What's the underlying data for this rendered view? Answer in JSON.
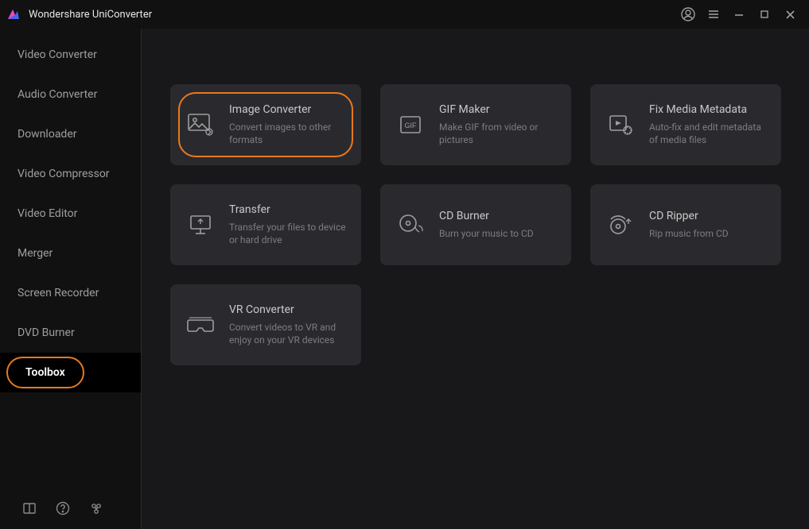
{
  "titlebar": {
    "app_name": "Wondershare UniConverter"
  },
  "sidebar": {
    "items": [
      {
        "label": "Video Converter",
        "id": "video-converter"
      },
      {
        "label": "Audio Converter",
        "id": "audio-converter"
      },
      {
        "label": "Downloader",
        "id": "downloader"
      },
      {
        "label": "Video Compressor",
        "id": "video-compressor"
      },
      {
        "label": "Video Editor",
        "id": "video-editor"
      },
      {
        "label": "Merger",
        "id": "merger"
      },
      {
        "label": "Screen Recorder",
        "id": "screen-recorder"
      },
      {
        "label": "DVD Burner",
        "id": "dvd-burner"
      },
      {
        "label": "Toolbox",
        "id": "toolbox",
        "active": true
      }
    ]
  },
  "cards": [
    {
      "id": "image-converter",
      "icon": "image-icon",
      "title": "Image Converter",
      "desc": "Convert images to other formats",
      "highlight": true
    },
    {
      "id": "gif-maker",
      "icon": "gif-icon",
      "title": "GIF Maker",
      "desc": "Make GIF from video or pictures"
    },
    {
      "id": "fix-media-metadata",
      "icon": "metadata-icon",
      "title": "Fix Media Metadata",
      "desc": "Auto-fix and edit metadata of media files"
    },
    {
      "id": "transfer",
      "icon": "transfer-icon",
      "title": "Transfer",
      "desc": "Transfer your files to device or hard drive"
    },
    {
      "id": "cd-burner",
      "icon": "cd-burner-icon",
      "title": "CD Burner",
      "desc": "Burn your music to CD"
    },
    {
      "id": "cd-ripper",
      "icon": "cd-ripper-icon",
      "title": "CD Ripper",
      "desc": "Rip music from CD"
    },
    {
      "id": "vr-converter",
      "icon": "vr-icon",
      "title": "VR Converter",
      "desc": "Convert videos to VR and enjoy on your VR devices"
    }
  ]
}
